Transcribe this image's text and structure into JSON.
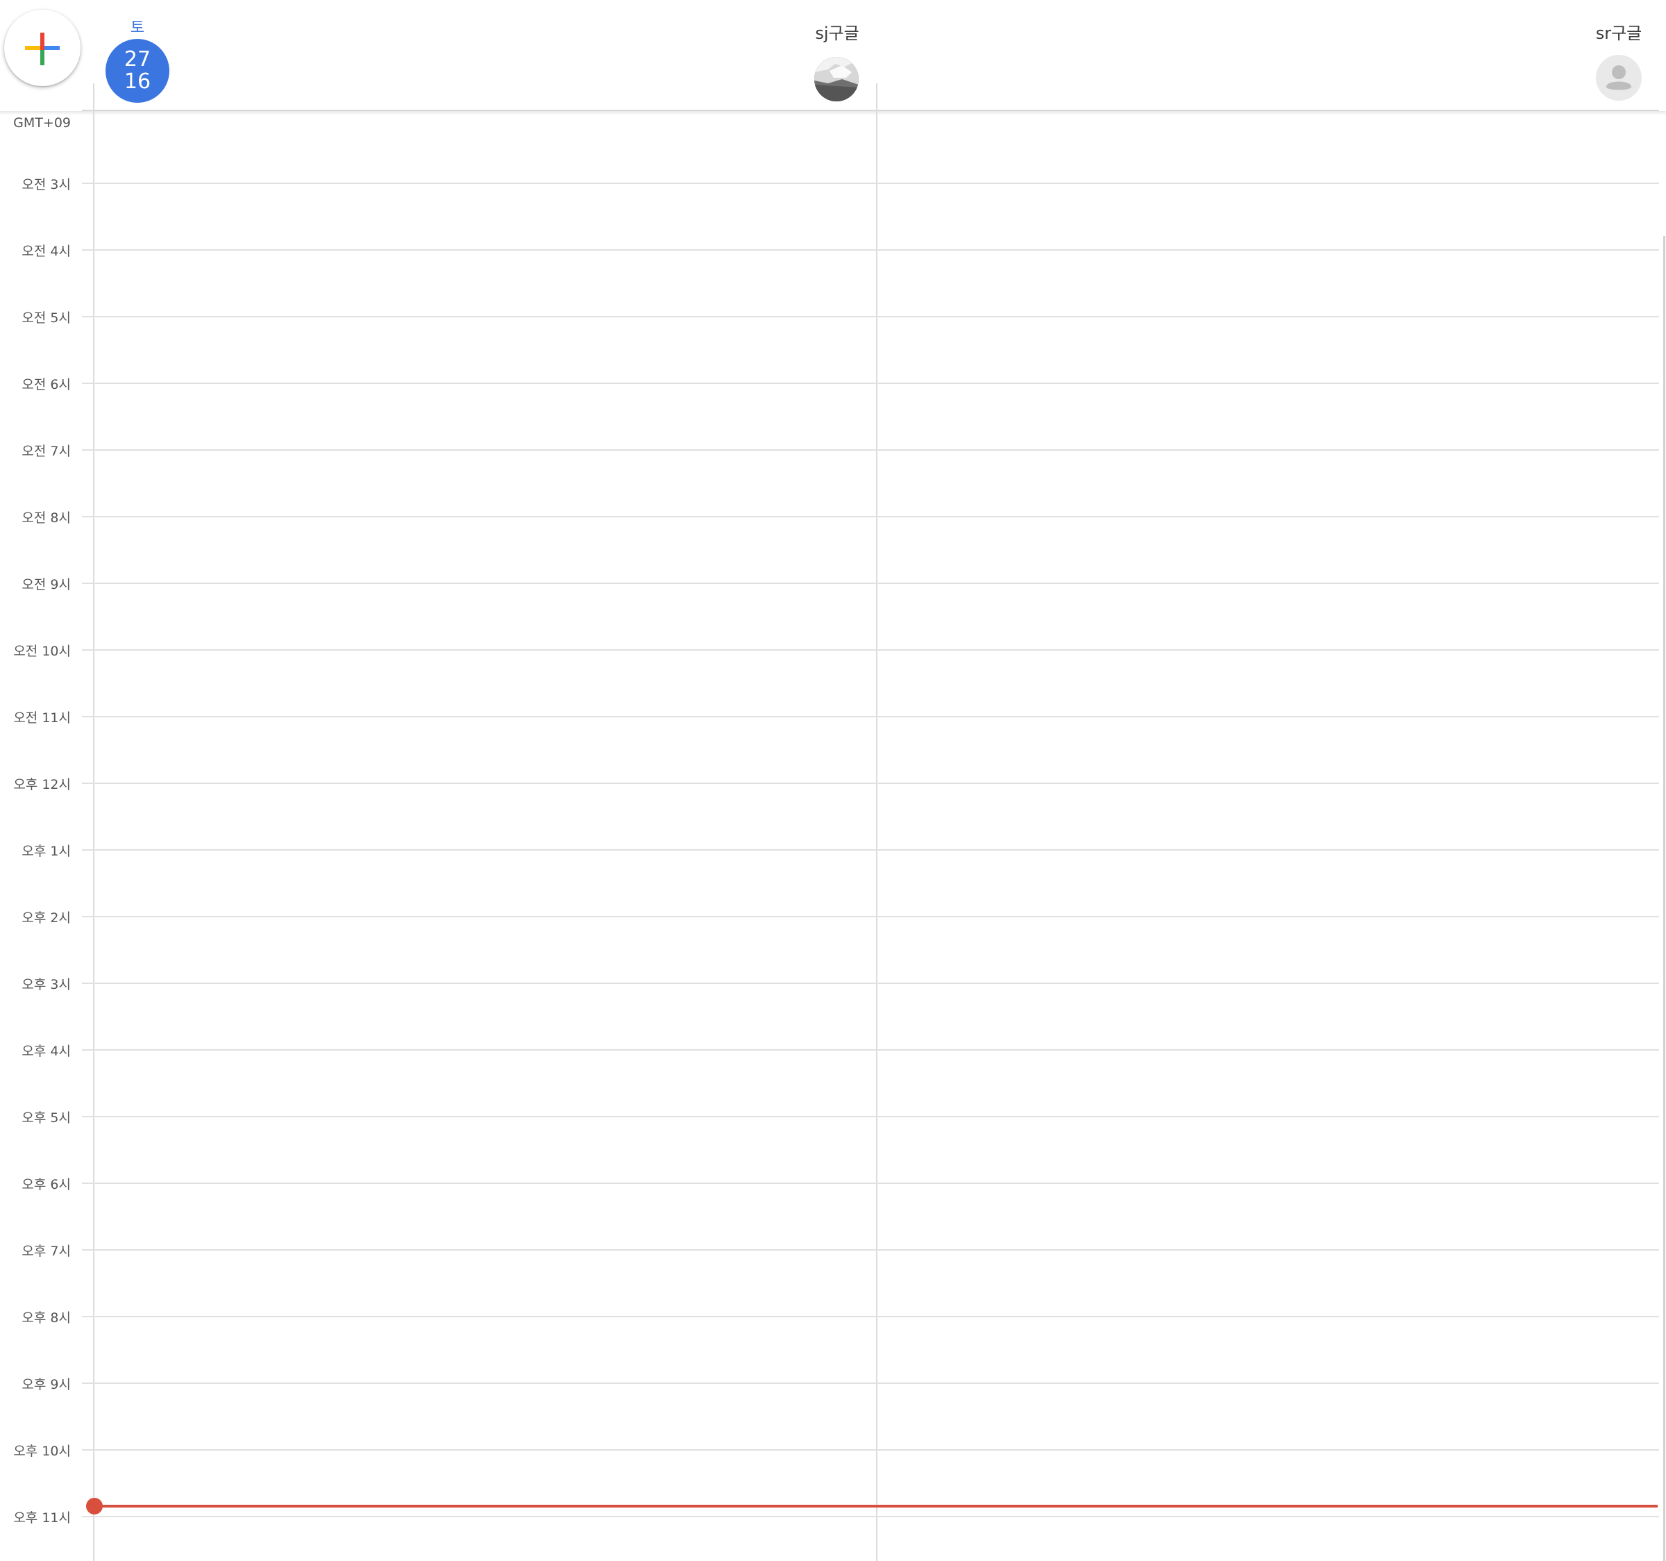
{
  "header": {
    "day_name": "토",
    "date_line1": "27",
    "date_line2": "16"
  },
  "people": [
    {
      "name": "sj구글",
      "avatar": "photo-avatar"
    },
    {
      "name": "sr구글",
      "avatar": "default-person-icon"
    }
  ],
  "timezone_label": "GMT+09",
  "hours": [
    "오전 3시",
    "오전 4시",
    "오전 5시",
    "오전 6시",
    "오전 7시",
    "오전 8시",
    "오전 9시",
    "오전 10시",
    "오전 11시",
    "오후 12시",
    "오후 1시",
    "오후 2시",
    "오후 3시",
    "오후 4시",
    "오후 5시",
    "오후 6시",
    "오후 7시",
    "오후 8시",
    "오후 9시",
    "오후 10시",
    "오후 11시"
  ],
  "colors": {
    "accent": "#3b75e0",
    "now_indicator": "#d94f3d",
    "fab_red": "#ea4335",
    "fab_blue": "#4285f4",
    "fab_green": "#34a853",
    "fab_yellow": "#fbbc05"
  }
}
